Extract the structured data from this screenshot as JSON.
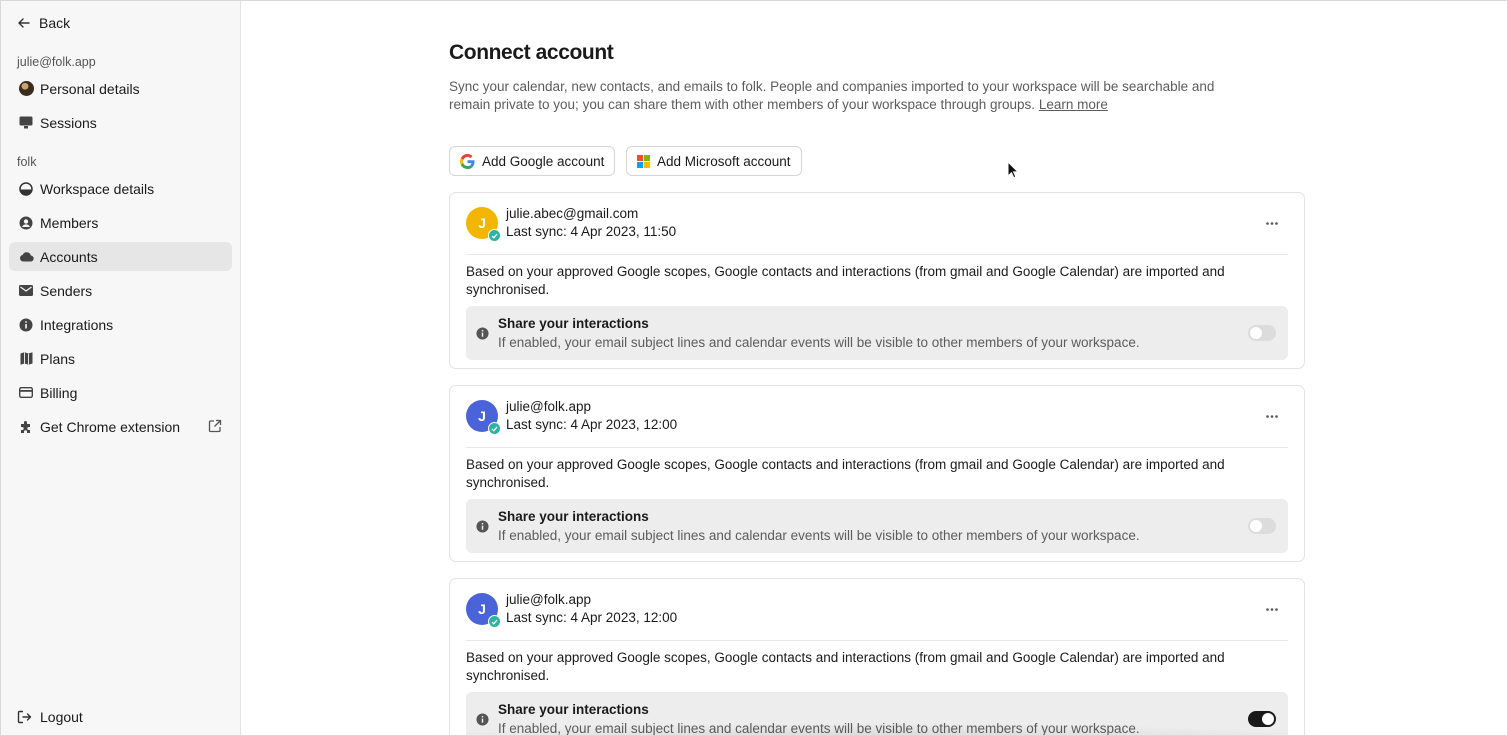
{
  "sidebar": {
    "back_label": "Back",
    "user_section": "julie@folk.app",
    "user_items": [
      {
        "label": "Personal details",
        "icon": "avatar-icon"
      },
      {
        "label": "Sessions",
        "icon": "monitor-icon"
      }
    ],
    "workspace_section": "folk",
    "workspace_items": [
      {
        "label": "Workspace details",
        "icon": "workspace-icon"
      },
      {
        "label": "Members",
        "icon": "user-circle-icon"
      },
      {
        "label": "Accounts",
        "icon": "cloud-icon",
        "active": true
      },
      {
        "label": "Senders",
        "icon": "mail-icon"
      },
      {
        "label": "Integrations",
        "icon": "info-icon"
      },
      {
        "label": "Plans",
        "icon": "map-icon"
      },
      {
        "label": "Billing",
        "icon": "credit-card-icon"
      },
      {
        "label": "Get Chrome extension",
        "icon": "puzzle-icon"
      }
    ],
    "logout_label": "Logout"
  },
  "main": {
    "title": "Connect account",
    "description": "Sync your calendar, new contacts, and emails to folk. People and companies imported to your workspace will be searchable and remain private to you; you can share them with other members of your workspace through groups.",
    "learn_more": "Learn more",
    "add_google": "Add Google account",
    "add_microsoft": "Add Microsoft account",
    "accounts": [
      {
        "initial": "J",
        "avatar_color": "#f2b500",
        "email": "julie.abec@gmail.com",
        "last_sync": "Last sync: 4 Apr 2023, 11:50",
        "body": "Based on your approved Google scopes, Google contacts and interactions (from gmail and Google Calendar) are imported and synchronised.",
        "share_title": "Share your interactions",
        "share_sub": "If enabled, your email subject lines and calendar events will be visible to other members of your workspace.",
        "share_enabled": false
      },
      {
        "initial": "J",
        "avatar_color": "#4a63d9",
        "email": "julie@folk.app",
        "last_sync": "Last sync: 4 Apr 2023, 12:00",
        "body": "Based on your approved Google scopes, Google contacts and interactions (from gmail and Google Calendar) are imported and synchronised.",
        "share_title": "Share your interactions",
        "share_sub": "If enabled, your email subject lines and calendar events will be visible to other members of your workspace.",
        "share_enabled": false
      },
      {
        "initial": "J",
        "avatar_color": "#4a63d9",
        "email": "julie@folk.app",
        "last_sync": "Last sync: 4 Apr 2023, 12:00",
        "body": "Based on your approved Google scopes, Google contacts and interactions (from gmail and Google Calendar) are imported and synchronised.",
        "share_title": "Share your interactions",
        "share_sub": "If enabled, your email subject lines and calendar events will be visible to other members of your workspace.",
        "share_enabled": true
      }
    ]
  }
}
